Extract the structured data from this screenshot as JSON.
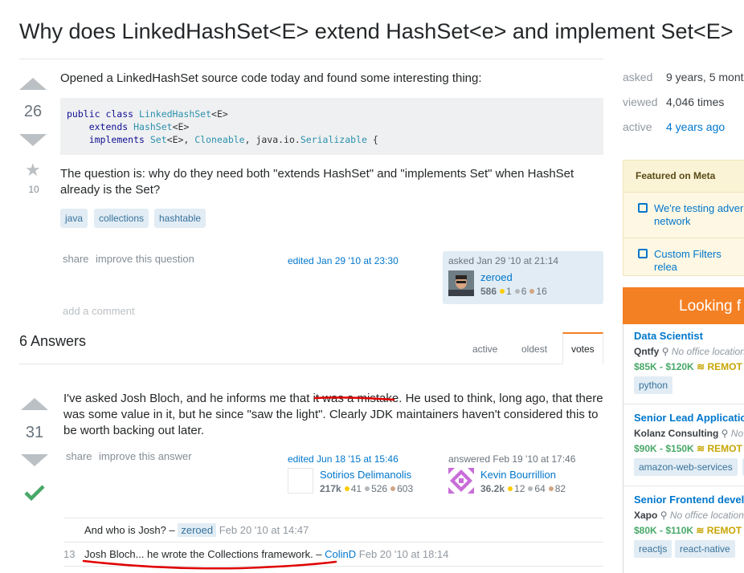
{
  "question": {
    "title": "Why does LinkedHashSet<E> extend HashSet<e> and implement Set<E>",
    "votes": "26",
    "favorites": "10",
    "intro": "Opened a LinkedHashSet source code today and found some interesting thing:",
    "code": {
      "line1_kw": "public class ",
      "line1_ty": "LinkedHashSet",
      "line1_rest": "<E>",
      "line2_kw": "extends ",
      "line2_ty": "HashSet",
      "line2_rest": "<E>",
      "line3_kw": "implements ",
      "line3_ty1": "Set",
      "line3_mid1": "<E>, ",
      "line3_ty2": "Cloneable",
      "line3_mid2": ", java.io.",
      "line3_ty3": "Serializable",
      "line3_end": " {"
    },
    "text_line1": "The question is: why do they need both \"extends HashSet\" and \"implements Set\" when HashSet",
    "text_line2": "already is the Set?",
    "tags": [
      "java",
      "collections",
      "hashtable"
    ],
    "share": "share",
    "improve": "improve this question",
    "edited": "edited Jan 29 '10 at 23:30",
    "asked": "asked Jan 29 '10 at 21:14",
    "owner": {
      "name": "zeroed",
      "rep": "586",
      "gold": "1",
      "silver": "6",
      "bronze": "16"
    },
    "add_comment": "add a comment"
  },
  "answers_header": "6 Answers",
  "sort_tabs": [
    "active",
    "oldest",
    "votes"
  ],
  "answer": {
    "votes": "31",
    "line1_a": "I've asked Josh Bloch, and he informs me that ",
    "line1_b": "it was a mistake",
    "line1_c": ". He used to think, long ago, that there",
    "line2": "was some value in it, but he since \"saw the light\". Clearly JDK maintainers haven't considered this to",
    "line3": "be worth backing out later.",
    "share": "share",
    "improve": "improve this answer",
    "edited": "edited Jun 18 '15 at 15:46",
    "editor": {
      "name": "Sotirios Delimanolis",
      "rep": "217k",
      "gold": "41",
      "silver": "526",
      "bronze": "603"
    },
    "answered": "answered Feb 19 '10 at 17:46",
    "author": {
      "name": "Kevin Bourrillion",
      "rep": "36.2k",
      "gold": "12",
      "silver": "64",
      "bronze": "82"
    }
  },
  "comments": [
    {
      "score": "",
      "text": "And who is Josh? – ",
      "user": "zeroed",
      "date": " Feb 20 '10 at 14:47"
    },
    {
      "score": "13",
      "text": "Josh Bloch... he wrote the Collections framework. – ",
      "user": "ColinD",
      "date": " Feb 20 '10 at 18:14"
    }
  ],
  "sidebar": {
    "asked_label": "asked",
    "asked_val": "9 years, 5 mont",
    "viewed_label": "viewed",
    "viewed_val": "4,046 times",
    "active_label": "active",
    "active_val": "4 years ago",
    "featured_head": "Featured on Meta",
    "featured_1a": "We're testing adver",
    "featured_1b": "network",
    "featured_2": "Custom Filters relea",
    "jobs_head": "Looking f",
    "jobs": [
      {
        "title": "Data Scientist",
        "company": "Qntfy",
        "location": " No office location",
        "salary": "$85K - $120K",
        "remote": " REMOT",
        "tags": [
          "python"
        ]
      },
      {
        "title": "Senior Lead Applicatio",
        "company": "Kolanz Consulting",
        "location": " No",
        "salary": "$90K - $150K",
        "remote": " REMOT",
        "tags": [
          "amazon-web-services",
          "r"
        ]
      },
      {
        "title": "Senior Frontend devel",
        "company": "Xapo",
        "location": " No office location",
        "salary": "$80K - $110K",
        "remote": " REMOT",
        "tags": [
          "reactjs",
          "react-native"
        ]
      }
    ]
  },
  "colors": {
    "link": "#0077cc",
    "accept": "#48a868",
    "orange": "#f48024",
    "annotation": "#e00000"
  }
}
